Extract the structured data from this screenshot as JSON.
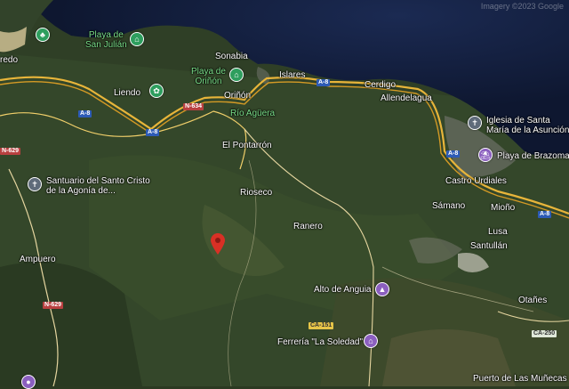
{
  "map": {
    "places": {
      "redo": "redo",
      "playa_san_julian": "Playa de\nSan Julián",
      "sonabia": "Sonabia",
      "playa_oriñon": "Playa de\nOriñón",
      "liendo": "Liendo",
      "oriñon": "Oriñón",
      "rio_aguera": "Río Agüera",
      "islares": "Islares",
      "cerdigo": "Cerdigo",
      "allendelagua": "Allendelagua",
      "iglesia": "Iglesia de Santa\nMaría de la Asunción",
      "playa_brazomar": "Playa de Brazomar",
      "el_pontarron": "El Pontarrón",
      "santuario": "Santuario del Santo Cristo\nde la Agonía de...",
      "castro_urdiales": "Castro Urdiales",
      "rioseco": "Rioseco",
      "samano": "Sámano",
      "mioño": "Mioño",
      "ranero": "Ranero",
      "lusa": "Lusa",
      "santullan": "Santullán",
      "ampuero": "Ampuero",
      "alto_anguia": "Alto de Anguia",
      "otañes": "Otañes",
      "ferreria": "Ferrería \"La Soledad\"",
      "puerto_muñecas": "Puerto de Las Muñecas"
    },
    "roads": {
      "a8_1": "A-8",
      "a8_2": "A-8",
      "a8_3": "A-8",
      "a8_4": "A-8",
      "a8_5": "A-8",
      "n634": "N-634",
      "n629a": "N-629",
      "n629b": "N-629",
      "ca151": "CA-151",
      "ca250": "CA-250"
    },
    "attribution": "Imagery ©2023 Google"
  }
}
